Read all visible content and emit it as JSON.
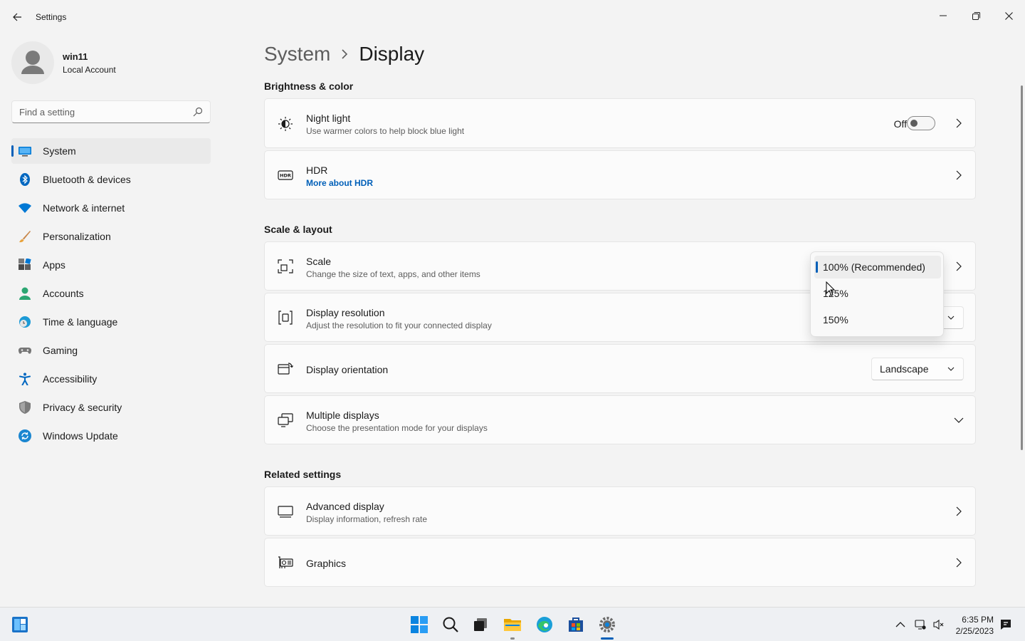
{
  "window": {
    "title": "Settings"
  },
  "user": {
    "name": "win11",
    "account_type": "Local Account"
  },
  "search": {
    "placeholder": "Find a setting"
  },
  "sidebar": {
    "items": [
      {
        "label": "System",
        "icon": "monitor-icon",
        "active": true
      },
      {
        "label": "Bluetooth & devices",
        "icon": "bluetooth-icon"
      },
      {
        "label": "Network & internet",
        "icon": "wifi-icon"
      },
      {
        "label": "Personalization",
        "icon": "brush-icon"
      },
      {
        "label": "Apps",
        "icon": "apps-icon"
      },
      {
        "label": "Accounts",
        "icon": "person-icon"
      },
      {
        "label": "Time & language",
        "icon": "globe-clock-icon"
      },
      {
        "label": "Gaming",
        "icon": "gamepad-icon"
      },
      {
        "label": "Accessibility",
        "icon": "accessibility-icon"
      },
      {
        "label": "Privacy & security",
        "icon": "shield-icon"
      },
      {
        "label": "Windows Update",
        "icon": "update-icon"
      }
    ]
  },
  "breadcrumb": {
    "parent": "System",
    "current": "Display"
  },
  "sections": {
    "brightness": "Brightness & color",
    "scale_layout": "Scale & layout",
    "related": "Related settings"
  },
  "cards": {
    "night_light": {
      "title": "Night light",
      "subtitle": "Use warmer colors to help block blue light",
      "toggle_state": "Off",
      "on": false
    },
    "hdr": {
      "title": "HDR",
      "link": "More about HDR"
    },
    "scale": {
      "title": "Scale",
      "subtitle": "Change the size of text, apps, and other items"
    },
    "resolution": {
      "title": "Display resolution",
      "subtitle": "Adjust the resolution to fit your connected display"
    },
    "orientation": {
      "title": "Display orientation",
      "value": "Landscape"
    },
    "multiple": {
      "title": "Multiple displays",
      "subtitle": "Choose the presentation mode for your displays"
    },
    "advanced": {
      "title": "Advanced display",
      "subtitle": "Display information, refresh rate"
    },
    "graphics": {
      "title": "Graphics"
    }
  },
  "scale_flyout": {
    "options": [
      "100% (Recommended)",
      "125%",
      "150%"
    ],
    "selected": "100% (Recommended)"
  },
  "taskbar": {
    "apps": [
      "start-icon",
      "search-icon",
      "task-view-icon",
      "file-explorer-icon",
      "edge-icon",
      "store-icon",
      "settings-icon"
    ],
    "time": "6:35 PM",
    "date": "2/25/2023"
  },
  "colors": {
    "accent": "#005fb8",
    "background": "#f3f3f3",
    "card": "#fbfbfb"
  }
}
